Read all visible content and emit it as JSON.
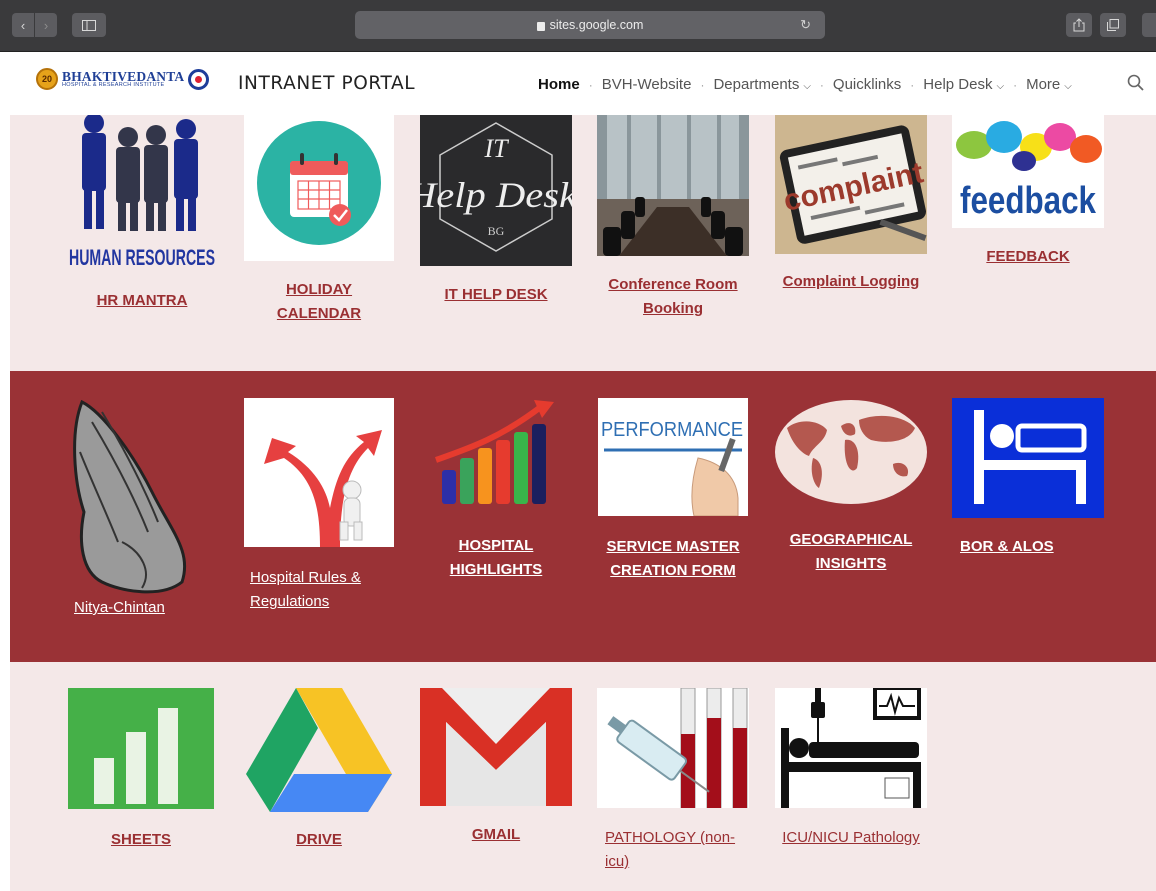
{
  "browser": {
    "url": "sites.google.com"
  },
  "header": {
    "logo_badge": "20",
    "logo_brand": "BHAKTIVEDANTA",
    "logo_sub": "HOSPITAL & RESEARCH INSTITUTE",
    "title": "INTRANET PORTAL",
    "nav": {
      "home": "Home",
      "bvh": "BVH-Website",
      "departments": "Departments",
      "quicklinks": "Quicklinks",
      "helpdesk": "Help Desk",
      "more": "More"
    }
  },
  "row1": {
    "hr": {
      "label": "HR MANTRA",
      "img_text": "HUMAN RESOURCES"
    },
    "holiday": {
      "line1": "HOLIDAY",
      "line2": "CALENDAR"
    },
    "ithelp": {
      "label": "IT HELP DESK",
      "img_it": "IT",
      "img_help": "Help Desk",
      "img_bg": "BG"
    },
    "conference": {
      "line1": "Conference Room",
      "line2": "Booking"
    },
    "complaint": {
      "label": "Complaint Logging",
      "img_text": "complaint"
    },
    "feedback": {
      "label": "FEEDBACK",
      "img_text": "feedback"
    }
  },
  "row2": {
    "nitya": {
      "label": "Nitya-Chintan"
    },
    "rules": {
      "line1": "Hospital Rules &",
      "line2": "Regulations"
    },
    "highlights": {
      "line1": "HOSPITAL",
      "line2": "HIGHLIGHTS"
    },
    "service": {
      "line1": "SERVICE MASTER",
      "line2": "CREATION FORM",
      "img_text": "PERFORMANCE"
    },
    "geo": {
      "line1": "GEOGRAPHICAL",
      "line2": "INSIGHTS"
    },
    "bor": {
      "label": "BOR & ALOS"
    }
  },
  "row3": {
    "sheets": {
      "label": "SHEETS"
    },
    "drive": {
      "label": "DRIVE"
    },
    "gmail": {
      "label": "GMAIL"
    },
    "pathology": {
      "line1": "PATHOLOGY (non-",
      "line2": "icu)"
    },
    "icu": {
      "label": "ICU/NICU Pathology"
    }
  },
  "colors": {
    "maroon": "#9a3236",
    "band_light": "#f4e8e8",
    "link_red": "#9a2f32"
  }
}
